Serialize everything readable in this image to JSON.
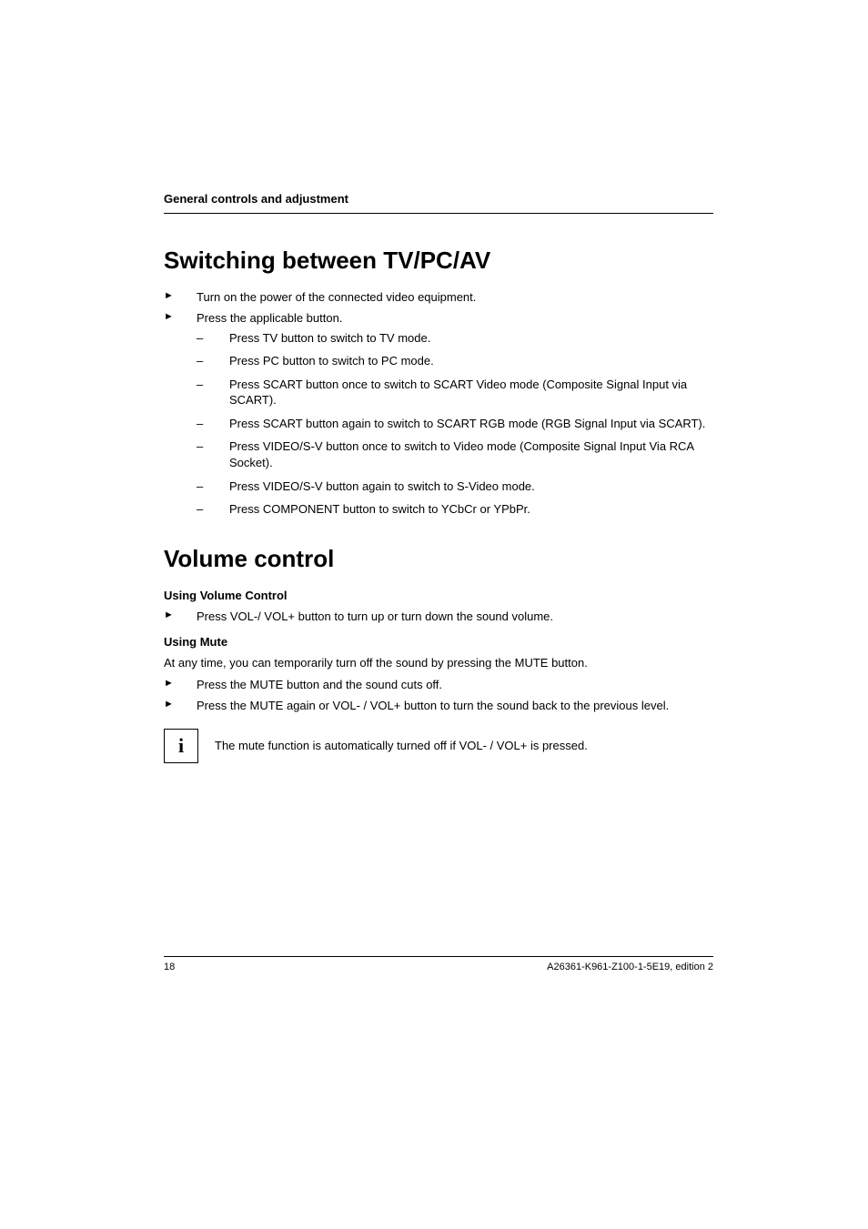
{
  "header": "General controls and adjustment",
  "section1": {
    "title": "Switching between TV/PC/AV",
    "steps": [
      "Turn on the power of the connected video equipment.",
      "Press the applicable button."
    ],
    "substeps": [
      "Press TV button to switch to TV mode.",
      "Press PC button to switch to PC mode.",
      "Press SCART button once to switch to SCART Video mode (Composite Signal Input via SCART).",
      "Press SCART button again to switch to SCART RGB mode (RGB Signal Input via SCART).",
      "Press VIDEO/S-V button once to switch to Video mode (Composite Signal Input Via RCA Socket).",
      "Press VIDEO/S-V button again to switch to S-Video mode.",
      "Press COMPONENT button to switch to YCbCr or YPbPr."
    ]
  },
  "section2": {
    "title": "Volume control",
    "vol_head": "Using Volume Control",
    "vol_steps": [
      "Press VOL-/ VOL+ button to turn up or turn down the sound volume."
    ],
    "mute_head": "Using Mute",
    "mute_intro": "At any time, you can temporarily turn off the sound by pressing the MUTE button.",
    "mute_steps": [
      "Press the MUTE button and the sound cuts off.",
      "Press the MUTE again or VOL- / VOL+ button to turn the sound back to the previous level."
    ],
    "info_glyph": "i",
    "info_text": "The mute function is automatically turned off if VOL- / VOL+ is pressed."
  },
  "footer": {
    "page": "18",
    "doc": "A26361-K961-Z100-1-5E19, edition 2"
  }
}
